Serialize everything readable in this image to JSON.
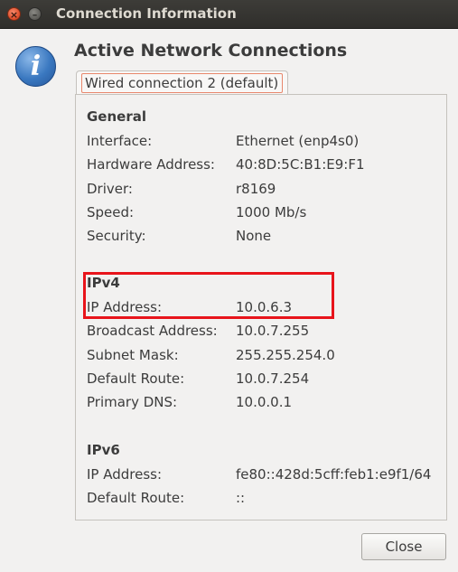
{
  "window": {
    "title": "Connection Information",
    "close_glyph": "×",
    "minimize_glyph": "–"
  },
  "dialog": {
    "icon": "information-icon",
    "icon_glyph": "i",
    "heading": "Active Network Connections",
    "tab_label": "Wired connection 2 (default)"
  },
  "general": {
    "title": "General",
    "rows": [
      {
        "label": "Interface:",
        "value": "Ethernet (enp4s0)"
      },
      {
        "label": "Hardware Address:",
        "value": "40:8D:5C:B1:E9:F1"
      },
      {
        "label": "Driver:",
        "value": "r8169"
      },
      {
        "label": "Speed:",
        "value": "1000 Mb/s"
      },
      {
        "label": "Security:",
        "value": "None"
      }
    ]
  },
  "ipv4": {
    "title": "IPv4",
    "rows": [
      {
        "label": "IP Address:",
        "value": "10.0.6.3"
      },
      {
        "label": "Broadcast Address:",
        "value": "10.0.7.255"
      },
      {
        "label": "Subnet Mask:",
        "value": "255.255.254.0"
      },
      {
        "label": "Default Route:",
        "value": "10.0.7.254"
      },
      {
        "label": "Primary DNS:",
        "value": "10.0.0.1"
      }
    ]
  },
  "ipv6": {
    "title": "IPv6",
    "rows": [
      {
        "label": "IP Address:",
        "value": "fe80::428d:5cff:feb1:e9f1/64"
      },
      {
        "label": "Default Route:",
        "value": "::"
      }
    ]
  },
  "buttons": {
    "close_label": "Close"
  },
  "colors": {
    "highlight": "#e8141b",
    "tab_focus": "#e8876c",
    "titlebar": "#3d3c38"
  }
}
